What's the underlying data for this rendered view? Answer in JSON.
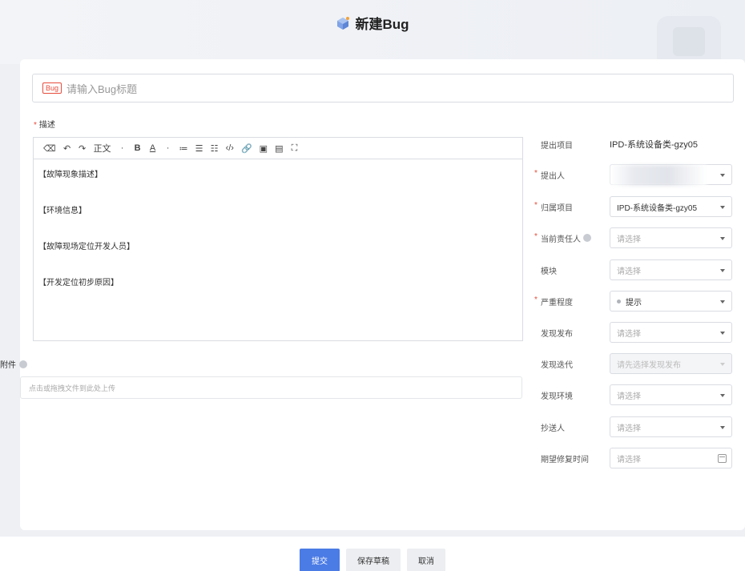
{
  "header": {
    "title": "新建Bug"
  },
  "title_input": {
    "tag": "Bug",
    "placeholder": "请输入Bug标题"
  },
  "description": {
    "label": "描述",
    "toolbar": [
      "⌫",
      "↶",
      "↷",
      "正文",
      "·",
      "B",
      "A",
      "·",
      "≔",
      "☰",
      "☷",
      "‹/›",
      "🔗",
      "▣",
      "▤",
      "⛶"
    ],
    "lines": [
      "【故障现象描述】",
      "【环境信息】",
      "【故障现场定位开发人员】",
      "【开发定位初步原因】"
    ]
  },
  "attachment": {
    "label": "附件",
    "placeholder": "点击或拖拽文件到此处上传"
  },
  "form": {
    "proposed_project": {
      "label": "提出项目",
      "value": "IPD-系统设备类-gzy05"
    },
    "proposer": {
      "label": "提出人",
      "value": ""
    },
    "belong_project": {
      "label": "归属项目",
      "value": "IPD-系统设备类-gzy05"
    },
    "assignee": {
      "label": "当前责任人",
      "placeholder": "请选择"
    },
    "module": {
      "label": "模块",
      "placeholder": "请选择"
    },
    "severity": {
      "label": "严重程度",
      "value": "提示"
    },
    "release": {
      "label": "发现发布",
      "placeholder": "请选择"
    },
    "iteration": {
      "label": "发现迭代",
      "placeholder": "请先选择发现发布"
    },
    "environment": {
      "label": "发现环境",
      "placeholder": "请选择"
    },
    "cc": {
      "label": "抄送人",
      "placeholder": "请选择"
    },
    "due_date": {
      "label": "期望修复时间",
      "placeholder": "请选择"
    }
  },
  "footer": {
    "submit": "提交",
    "save_draft": "保存草稿",
    "cancel": "取消"
  }
}
